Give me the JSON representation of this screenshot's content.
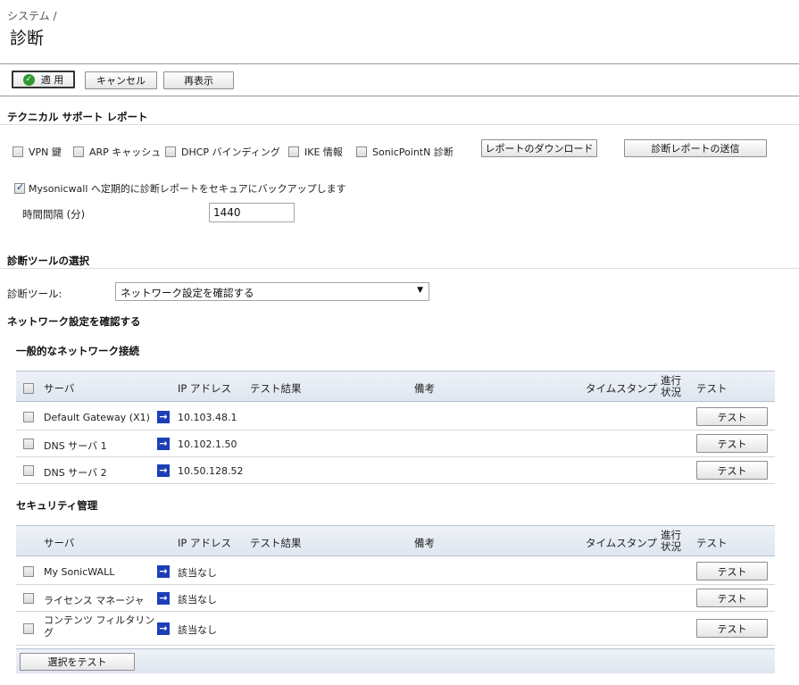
{
  "header": {
    "breadcrumb": "システム /",
    "title": "診断"
  },
  "toolbar": {
    "apply_label": "適 用",
    "cancel_label": "キャンセル",
    "refresh_label": "再表示"
  },
  "tech_support": {
    "title": "テクニカル サポート レポート",
    "options": [
      {
        "label": "VPN 鍵",
        "checked": false
      },
      {
        "label": "ARP キャッシュ",
        "checked": false
      },
      {
        "label": "DHCP バインディング",
        "checked": false
      },
      {
        "label": "IKE 情報",
        "checked": false
      },
      {
        "label": "SonicPointN 診断",
        "checked": false
      }
    ],
    "download_label": "レポートのダウンロード",
    "send_label": "診断レポートの送信",
    "backup_label": "Mysonicwall へ定期的に診断レポートをセキュアにバックアップします",
    "backup_checked": true,
    "interval_label": "時間間隔 (分)",
    "interval_value": "1440"
  },
  "tool_select": {
    "title": "診断ツールの選択",
    "label": "診断ツール:",
    "selected": "ネットワーク設定を確認する"
  },
  "network_check": {
    "title": "ネットワーク設定を確認する",
    "columns": {
      "server": "サーバ",
      "ip": "IP アドレス",
      "result": "テスト結果",
      "notes": "備考",
      "timestamp": "タイムスタンプ",
      "progress": "進行\n状況",
      "test": "テスト"
    },
    "general": {
      "title": "一般的なネットワーク接続",
      "rows": [
        {
          "server": "Default Gateway (X1)",
          "ip": "10.103.48.1",
          "test": "テスト"
        },
        {
          "server": "DNS サーバ 1",
          "ip": "10.102.1.50",
          "test": "テスト"
        },
        {
          "server": "DNS サーバ 2",
          "ip": "10.50.128.52",
          "test": "テスト"
        }
      ]
    },
    "security": {
      "title": "セキュリティ管理",
      "rows": [
        {
          "server": "My SonicWALL",
          "ip": "該当なし",
          "test": "テスト"
        },
        {
          "server": "ライセンス マネージャ",
          "ip": "該当なし",
          "test": "テスト"
        },
        {
          "server": "コンテンツ フィルタリン\nグ",
          "ip": "該当なし",
          "test": "テスト"
        }
      ]
    },
    "test_selected_label": "選択をテスト"
  },
  "colors": {
    "header_bg": "#dfe6f0",
    "arrow_icon": "#1c3fb8",
    "apply_icon": "#2f9a2f"
  }
}
